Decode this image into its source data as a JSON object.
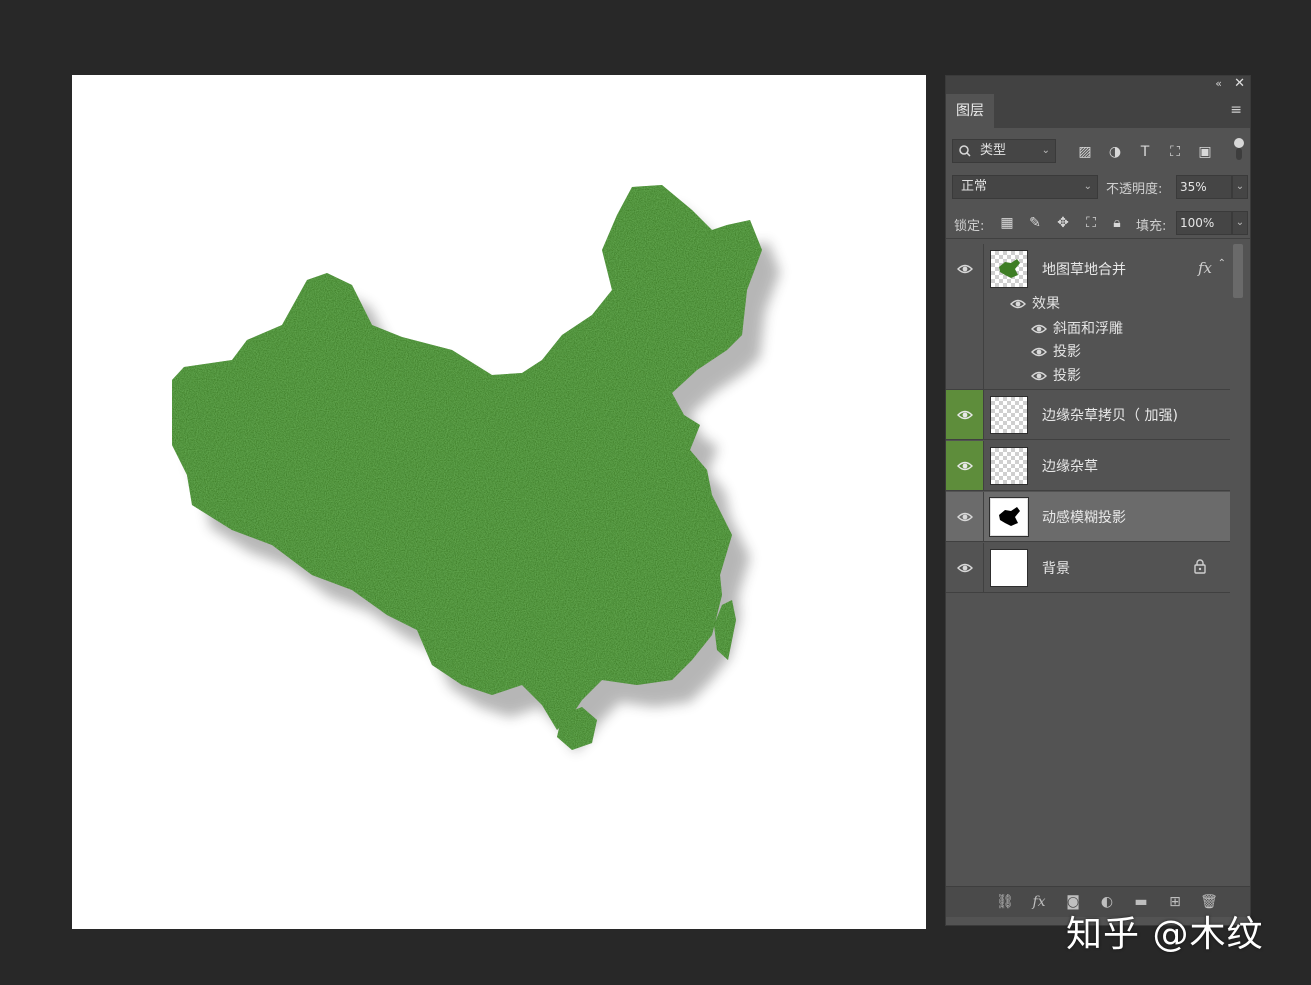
{
  "panel": {
    "tab": "图层",
    "filter": {
      "kind_label": "类型",
      "search_glyph": "🔍"
    },
    "blend_mode": "正常",
    "opacity_label": "不透明度:",
    "opacity_value": "35%",
    "lock_label": "锁定:",
    "fill_label": "填充:",
    "fill_value": "100%",
    "layers": [
      {
        "name": "地图草地合并",
        "visible": true,
        "thumbnail": "grass-map",
        "fx": "fx"
      },
      {
        "name": "边缘杂草拷贝（ 加强)",
        "visible": true,
        "thumbnail": "transparent",
        "highlight_eye": true
      },
      {
        "name": "边缘杂草",
        "visible": true,
        "thumbnail": "transparent",
        "highlight_eye": true
      },
      {
        "name": "动感模糊投影",
        "visible": true,
        "thumbnail": "black-map-mask",
        "selected": true
      },
      {
        "name": "背景",
        "visible": true,
        "thumbnail": "white",
        "locked": true
      }
    ],
    "effects": {
      "header": "效果",
      "items": [
        "斜面和浮雕",
        "投影",
        "投影"
      ]
    }
  },
  "icons": {
    "filter_icons": [
      "image-icon",
      "adjustment-icon",
      "type-icon",
      "shape-icon",
      "smart-object-icon"
    ],
    "lock_icons": [
      "lock-transparency-icon",
      "lock-paint-icon",
      "lock-position-icon",
      "lock-artboard-icon",
      "lock-all-icon"
    ],
    "bottom_icons": [
      "link-icon",
      "fx-icon",
      "mask-icon",
      "adjustment-layer-icon",
      "group-icon",
      "new-layer-icon",
      "trash-icon"
    ]
  },
  "colors": {
    "grass": "#3f7f24",
    "eye_highlight": "#5e8d3b",
    "selected_row": "#6b6b6b"
  },
  "watermark": "知乎 @木纹"
}
